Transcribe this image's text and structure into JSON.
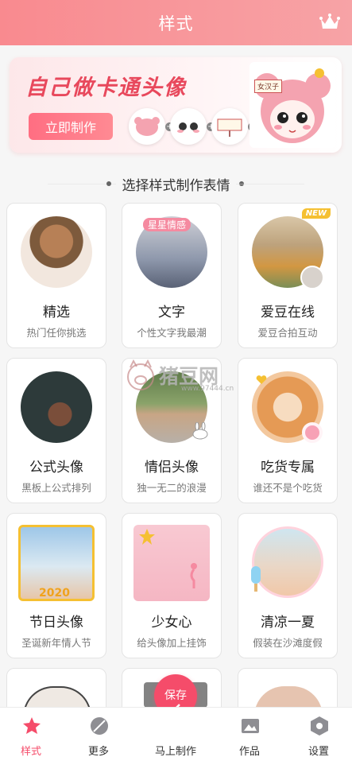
{
  "header": {
    "title": "样式",
    "crown_icon": "crown-icon"
  },
  "banner": {
    "title": "自己做卡通头像",
    "button_label": "立即制作",
    "sign_text": "女汉子",
    "accent": "#e8485c"
  },
  "section": {
    "title": "选择样式制作表情"
  },
  "cards": [
    {
      "title": "精选",
      "subtitle": "热门任你挑选"
    },
    {
      "title": "文字",
      "subtitle": "个性文字我最潮",
      "overlay": "星星情感"
    },
    {
      "title": "爱豆在线",
      "subtitle": "爱豆合拍互动",
      "badge": "NEW"
    },
    {
      "title": "公式头像",
      "subtitle": "黑板上公式排列"
    },
    {
      "title": "情侣头像",
      "subtitle": "独一无二的浪漫"
    },
    {
      "title": "吃货专属",
      "subtitle": "谁还不是个吃货"
    },
    {
      "title": "节日头像",
      "subtitle": "圣诞新年情人节",
      "year": "2020"
    },
    {
      "title": "少女心",
      "subtitle": "给头像加上挂饰"
    },
    {
      "title": "清凉一夏",
      "subtitle": "假装在沙滩度假"
    }
  ],
  "watermark": {
    "text": "猪豆网",
    "url": "www.97444.cn"
  },
  "save_bubble": {
    "label": "保存"
  },
  "nav": {
    "items": [
      {
        "label": "样式",
        "icon": "style-brush-icon"
      },
      {
        "label": "更多",
        "icon": "compass-icon"
      },
      {
        "label": "马上制作",
        "icon": "edit-pen-icon"
      },
      {
        "label": "作品",
        "icon": "gallery-icon"
      },
      {
        "label": "设置",
        "icon": "settings-hex-icon"
      }
    ]
  },
  "colors": {
    "header": "#f98a8f",
    "primary": "#f54c6a"
  }
}
